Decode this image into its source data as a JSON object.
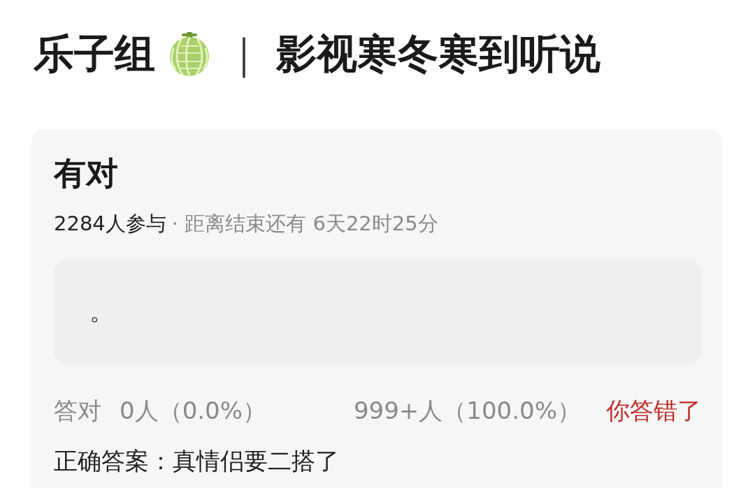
{
  "header": {
    "group": "乐子组",
    "separator": "｜",
    "topic": "影视寒冬寒到听说"
  },
  "poll": {
    "title": "有对",
    "participants": "2284人参与",
    "deadline": "· 距离结束还有 6天22时25分",
    "answer": {
      "value": "。"
    },
    "stats": [
      {
        "label": "答对",
        "value": "0人（0.0%）"
      },
      {
        "value": "999+人（100.0%）"
      }
    ],
    "verdict": {
      "text": "你答错了",
      "correct": false
    },
    "correct_answer": "正确答案：真情侣要二搭了"
  }
}
